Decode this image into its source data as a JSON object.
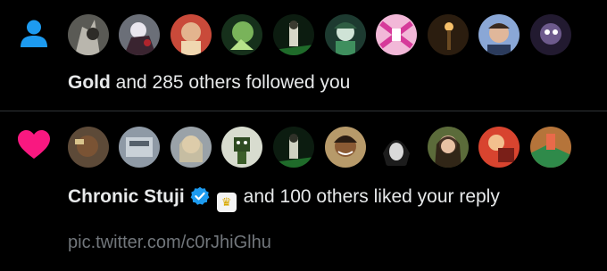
{
  "colors": {
    "background": "#000000",
    "text_primary": "#e7e9ea",
    "text_secondary": "#71767b",
    "follow_icon": "#1d9bf0",
    "like_icon": "#f91880",
    "verified": "#1d9bf0",
    "divider": "#2f3336"
  },
  "follow_notification": {
    "icon": "person-icon",
    "avatar_count": 10,
    "actor_name": "Gold",
    "rest_text": " and 285 others followed you"
  },
  "like_notification": {
    "icon": "heart-icon",
    "avatar_count": 10,
    "actor_name": "Chronic Stuji",
    "verified_icon": "verified-badge-icon",
    "affiliate_badge_icon": "crown-icon",
    "affiliate_badge_glyph": "♛",
    "rest_text": "and 100 others liked your reply",
    "link_text": "pic.twitter.com/c0rJhiGlhu"
  }
}
